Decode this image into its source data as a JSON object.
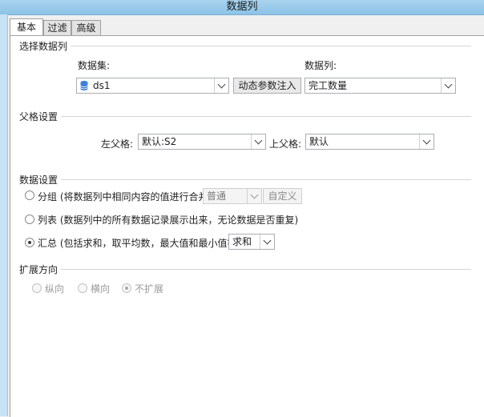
{
  "window": {
    "title": "数据列"
  },
  "tabs": [
    {
      "label": "基本"
    },
    {
      "label": "过滤"
    },
    {
      "label": "高级"
    }
  ],
  "select_column": {
    "section": "选择数据列",
    "dataset_label": "数据集:",
    "dataset_value": "ds1",
    "column_label": "数据列:",
    "dynamic_param_button": "动态参数注入",
    "column_value": "完工数量",
    "dataset_icon": "database-icon"
  },
  "parent_settings": {
    "section": "父格设置",
    "left_label": "左父格:",
    "left_value": "默认:S2",
    "top_label": "上父格:",
    "top_value": "默认"
  },
  "data_settings": {
    "section": "数据设置",
    "group_label": "分组 (将数据列中相同内容的值进行合并)",
    "group_mode": "普通",
    "custom_button": "自定义",
    "list_label": "列表 (数据列中的所有数据记录展示出来，无论数据是否重复)",
    "summary_label": "汇总 (包括求和，取平均数，最大值和最小值等)",
    "summary_func": "求和",
    "selected": "summary"
  },
  "expand": {
    "section": "扩展方向",
    "vertical": "纵向",
    "horizontal": "横向",
    "none": "不扩展",
    "selected": "none"
  }
}
